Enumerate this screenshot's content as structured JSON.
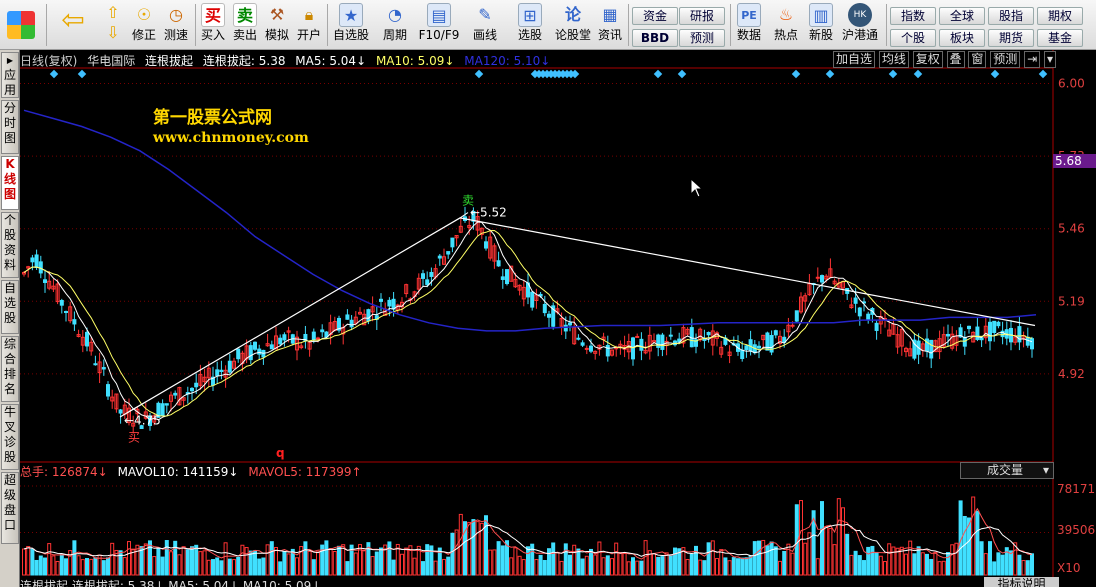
{
  "toolbar": {
    "left_buttons": [
      {
        "name": "back-button",
        "label": "",
        "icon": "arrow-left-icon"
      },
      {
        "name": "pageup-button",
        "label": "",
        "icon": "arrow-up-icon"
      },
      {
        "name": "fix-button",
        "label": "修正",
        "icon": "gear-icon"
      },
      {
        "name": "speed-button",
        "label": "测速",
        "icon": "clock-icon"
      },
      {
        "name": "buy-button",
        "label": "买入",
        "icon": "buy-icon"
      },
      {
        "name": "sell-button",
        "label": "卖出",
        "icon": "sell-icon"
      },
      {
        "name": "simulate-button",
        "label": "模拟",
        "icon": "hammer-icon"
      },
      {
        "name": "open-account-button",
        "label": "开户",
        "icon": "lock-icon"
      },
      {
        "name": "self-select-button",
        "label": "自选股",
        "icon": "star-icon"
      },
      {
        "name": "period-button",
        "label": "周期",
        "icon": "period-icon"
      },
      {
        "name": "f10-button",
        "label": "F10/F9",
        "icon": "f10-icon"
      },
      {
        "name": "draw-button",
        "label": "画线",
        "icon": "pen-icon"
      },
      {
        "name": "stock-select-button",
        "label": "选股",
        "icon": "select-icon"
      },
      {
        "name": "forum-button",
        "label": "论股堂",
        "icon": "forum-icon"
      },
      {
        "name": "news-button",
        "label": "资讯",
        "icon": "news-icon"
      },
      {
        "name": "data-button",
        "label": "数据",
        "icon": "pe-icon"
      },
      {
        "name": "hot-button",
        "label": "热点",
        "icon": "hot-icon"
      },
      {
        "name": "new-stock-button",
        "label": "新股",
        "icon": "new-icon"
      },
      {
        "name": "hk-connect-button",
        "label": "沪港通",
        "icon": "hk-icon"
      }
    ],
    "small_buttons": {
      "funds": "资金",
      "bbd": "BBD",
      "research": "研报",
      "forecast": "预测",
      "index": "指数",
      "global": "全球",
      "stock_index": "股指",
      "futures": "期权",
      "individual": "个股",
      "sector": "板块",
      "options": "期货",
      "fund": "基金"
    }
  },
  "left_tabs": [
    {
      "label": "应用",
      "active": false
    },
    {
      "label": "分时图",
      "active": false
    },
    {
      "label": "K线图",
      "active": true
    },
    {
      "label": "个股资料",
      "active": false
    },
    {
      "label": "自选股",
      "active": false
    },
    {
      "label": "综合排名",
      "active": false
    },
    {
      "label": "牛叉诊股",
      "active": false
    },
    {
      "label": "超级盘口",
      "active": false
    }
  ],
  "infobar": {
    "period": "日线(复权)",
    "stock": "华电国际",
    "indicator": "连根拔起",
    "ind_value": "连根拔起: 5.38",
    "ma5": "MA5: 5.04↓",
    "ma10": "MA10: 5.09↓",
    "ma120": "MA120: 5.10↓"
  },
  "right_controls": [
    "加自选",
    "均线",
    "复权",
    "叠",
    "窗",
    "预测"
  ],
  "watermark": {
    "line1": "第一股票公式网",
    "line2": "www.chnmoney.com"
  },
  "price_axis": {
    "labels": [
      "6.00",
      "5.73",
      "5.46",
      "5.19",
      "4.92"
    ],
    "current": "5.68"
  },
  "annotations": {
    "high": "5.52",
    "low": "4.75",
    "sell": "卖",
    "buy": "买",
    "marker": "q"
  },
  "volume": {
    "total": "总手: 126874↓",
    "mavol10": "MAVOL10: 141159↓",
    "mavol5": "MAVOL5: 117399↑",
    "selector": "成交量",
    "axis": [
      "78171",
      "39506"
    ],
    "unit": "X10"
  },
  "bottombar": {
    "text": "连根拔起  连根拔起: 5.38↓  MA5: 5.04↓  MA10: 5.09↓",
    "help": "指标说明"
  },
  "colors": {
    "up": "#ff3333",
    "down": "#40e0ff",
    "ma5": "#ffffff",
    "ma10": "#ffff66",
    "ma120": "#2424c8"
  },
  "chart_data": {
    "type": "candlestick",
    "ylim": [
      4.6,
      6.05
    ],
    "ma120": [
      5.9,
      5.87,
      5.84,
      5.8,
      5.75,
      5.68,
      5.6,
      5.52,
      5.43,
      5.36,
      5.29,
      5.23,
      5.18,
      5.14,
      5.11,
      5.09,
      5.08,
      5.08,
      5.09,
      5.095,
      5.1,
      5.1,
      5.1,
      5.105,
      5.11,
      5.11,
      5.11,
      5.11,
      5.11,
      5.12,
      5.12,
      5.12,
      5.13,
      5.13,
      5.13,
      5.14
    ]
  }
}
